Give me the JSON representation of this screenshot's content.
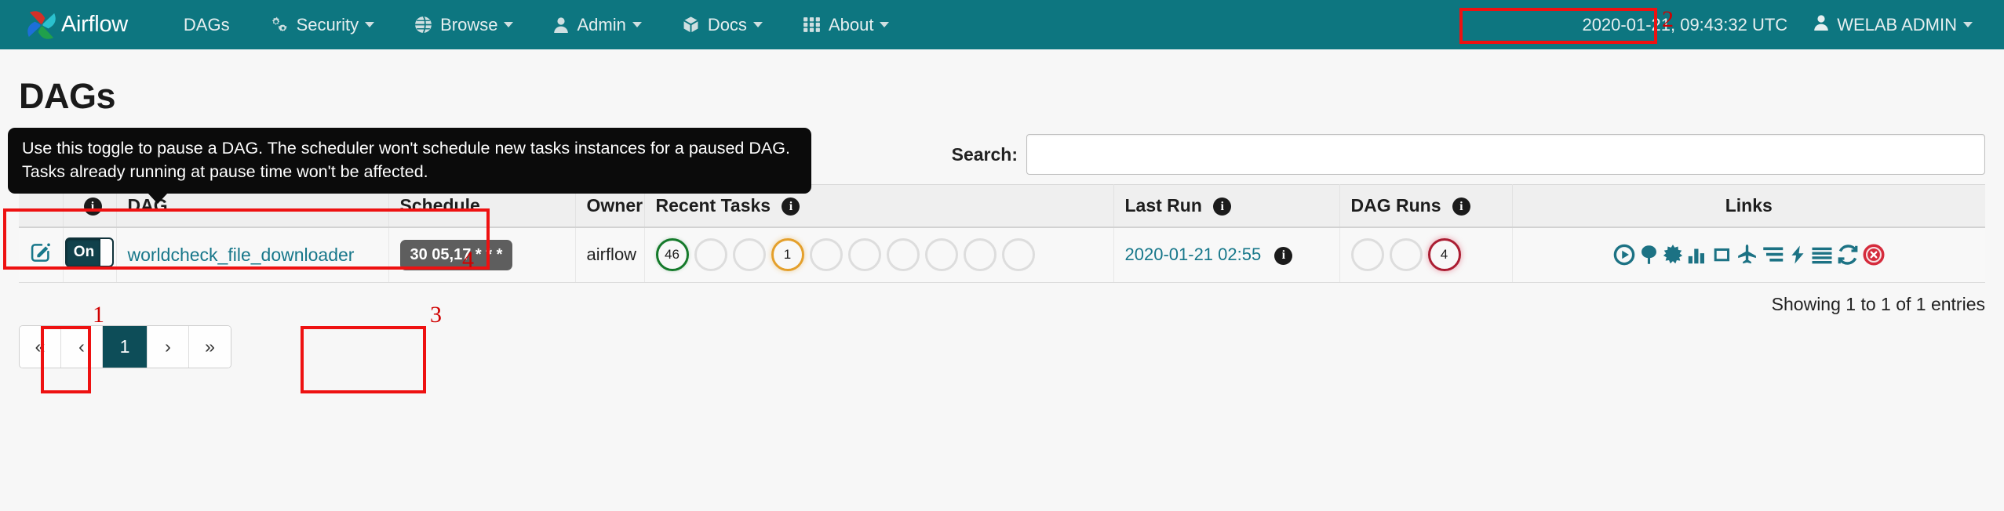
{
  "navbar": {
    "brand": "Airflow",
    "brand_icon": "airflow-pinwheel-logo",
    "items": [
      {
        "label": "DAGs",
        "icon": "",
        "caret": false
      },
      {
        "label": "Security",
        "icon": "gears-icon",
        "caret": true
      },
      {
        "label": "Browse",
        "icon": "globe-icon",
        "caret": true
      },
      {
        "label": "Admin",
        "icon": "user-icon",
        "caret": true
      },
      {
        "label": "Docs",
        "icon": "cube-icon",
        "caret": true
      },
      {
        "label": "About",
        "icon": "grid-icon",
        "caret": true
      }
    ],
    "clock": "2020-01-21, 09:43:32 UTC",
    "user": "WELAB ADMIN",
    "user_icon": "user-icon",
    "bg_color": "#0d7680"
  },
  "page": {
    "title": "DAGs"
  },
  "tooltip": {
    "text": "Use this toggle to pause a DAG. The scheduler won't schedule new tasks instances for a paused DAG. Tasks already running at pause time won't be affected."
  },
  "search": {
    "label": "Search:",
    "value": "",
    "placeholder": ""
  },
  "table": {
    "headers": {
      "info": "",
      "dag": "DAG",
      "schedule": "Schedule",
      "owner": "Owner",
      "recent_tasks": "Recent Tasks",
      "last_run": "Last Run",
      "dag_runs": "DAG Runs",
      "links": "Links"
    },
    "info_glyph": "i",
    "rows": [
      {
        "edit_icon": "edit-pencil-icon",
        "toggle": {
          "state": "On",
          "is_on": true
        },
        "dag_id": "worldcheck_file_downloader",
        "schedule": "30 05,17 * * *",
        "owner": "airflow",
        "recent_tasks": [
          {
            "value": "46",
            "state": "success"
          },
          {
            "value": "",
            "state": "empty"
          },
          {
            "value": "",
            "state": "empty"
          },
          {
            "value": "1",
            "state": "running"
          },
          {
            "value": "",
            "state": "empty"
          },
          {
            "value": "",
            "state": "empty"
          },
          {
            "value": "",
            "state": "empty"
          },
          {
            "value": "",
            "state": "empty"
          },
          {
            "value": "",
            "state": "empty"
          },
          {
            "value": "",
            "state": "empty"
          }
        ],
        "last_run": "2020-01-21 02:55",
        "dag_runs": [
          {
            "value": "",
            "state": "empty"
          },
          {
            "value": "",
            "state": "empty"
          },
          {
            "value": "4",
            "state": "failed"
          }
        ],
        "links": [
          "trigger-dag-icon",
          "tree-view-icon",
          "graph-view-icon",
          "task-duration-icon",
          "task-tries-icon",
          "landing-times-icon",
          "gantt-icon",
          "details-icon",
          "code-icon",
          "refresh-icon",
          "delete-dag-icon"
        ]
      }
    ]
  },
  "footer": {
    "showing": "Showing 1 to 1 of 1 entries",
    "pagination": [
      {
        "label": "«",
        "name": "first-page",
        "active": false
      },
      {
        "label": "‹",
        "name": "prev-page",
        "active": false
      },
      {
        "label": "1",
        "name": "page-1",
        "active": true
      },
      {
        "label": "›",
        "name": "next-page",
        "active": false
      },
      {
        "label": "»",
        "name": "last-page",
        "active": false
      }
    ]
  },
  "annotations": [
    {
      "number": "1",
      "target": "dag-pause-toggle"
    },
    {
      "number": "2",
      "target": "navbar-clock"
    },
    {
      "number": "3",
      "target": "schedule-cell"
    },
    {
      "number": "4",
      "target": "pause-tooltip"
    }
  ],
  "colors": {
    "accent": "#0d7680",
    "link": "#17778a",
    "success": "#157a2b",
    "running": "#e4a02c",
    "failed": "#ab1e33",
    "annotation": "#ee1111"
  }
}
